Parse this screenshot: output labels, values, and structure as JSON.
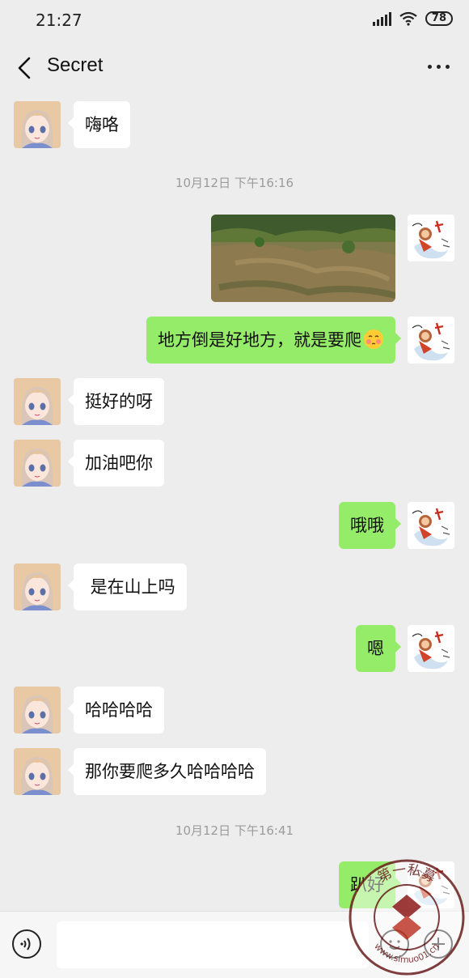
{
  "status_bar": {
    "time": "21:27",
    "battery": "78"
  },
  "nav": {
    "title": "Secret",
    "back_icon": "chevron-left-icon",
    "more_icon": "more-dots-icon"
  },
  "messages": [
    {
      "side": "in",
      "text": "嗨咯"
    },
    {
      "type": "time",
      "text": "10月12日 下午16:16"
    },
    {
      "side": "out",
      "type": "image",
      "description": "photo of a hillside"
    },
    {
      "side": "out",
      "text": "地方倒是好地方，就是要爬"
    },
    {
      "side": "in",
      "text": "挺好的呀"
    },
    {
      "side": "in",
      "text": "加油吧你"
    },
    {
      "side": "out",
      "text": "哦哦"
    },
    {
      "side": "in",
      "text": " 是在山上吗"
    },
    {
      "side": "out",
      "text": "嗯"
    },
    {
      "side": "in",
      "text": "哈哈哈哈"
    },
    {
      "side": "in",
      "text": "那你要爬多久哈哈哈哈"
    },
    {
      "type": "time",
      "text": "10月12日 下午16:41"
    },
    {
      "side": "out",
      "text": "趴好"
    }
  ],
  "watermark": {
    "text_top": "第一私募",
    "text_bottom": "www.simuo01.cn"
  },
  "colors": {
    "background": "#EDEDED",
    "outgoing_bubble": "#95EC69",
    "incoming_bubble": "#FFFFFF"
  }
}
